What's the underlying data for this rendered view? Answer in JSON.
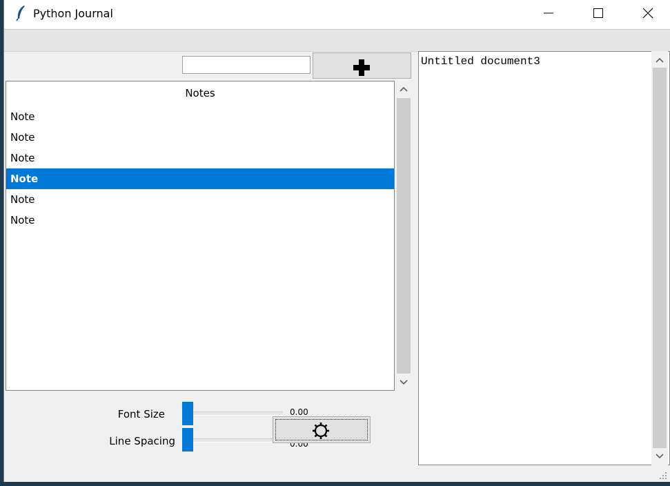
{
  "window": {
    "title": "Python Journal",
    "app_icon": "feather-icon",
    "controls": [
      "minimize-icon",
      "maximize-icon",
      "close-icon"
    ]
  },
  "toolbar": {
    "search_value": "",
    "add_icon": "plus-icon"
  },
  "notes": {
    "header": "Notes",
    "items": [
      {
        "label": "Note",
        "selected": false
      },
      {
        "label": "Note",
        "selected": false
      },
      {
        "label": "Note",
        "selected": false
      },
      {
        "label": "Note",
        "selected": true
      },
      {
        "label": "Note",
        "selected": false
      },
      {
        "label": "Note",
        "selected": false
      }
    ]
  },
  "settings": {
    "font_size_label": "Font Size",
    "font_size_value": "0.00",
    "line_spacing_label": "Line Spacing",
    "line_spacing_value": "0.00",
    "settings_icon": "gear-icon"
  },
  "editor": {
    "content": "Untitled document3"
  },
  "colors": {
    "accent": "#0078d7",
    "scrollbar_thumb": "#cdcdcd",
    "window_bg": "#f0f0f0"
  }
}
